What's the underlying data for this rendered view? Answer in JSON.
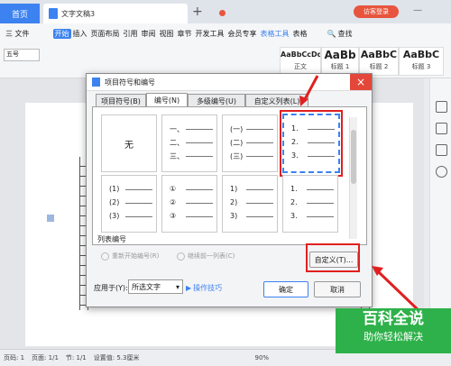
{
  "titlebar": {
    "home_tab": "首页",
    "doc_tab": "文字文稿3",
    "login": "访客登录"
  },
  "menubar": {
    "file": "三 文件",
    "items": [
      "开始",
      "插入",
      "页面布局",
      "引用",
      "审阅",
      "视图",
      "章节",
      "开发工具",
      "会员专享",
      "表格工具",
      "表格"
    ],
    "search": "查找"
  },
  "ribbon": {
    "font_size": "五号",
    "styles": [
      {
        "sample": "AaBbCcDd",
        "name": "正文"
      },
      {
        "sample": "AaBb",
        "name": "标题 1"
      },
      {
        "sample": "AaBbC",
        "name": "标题 2"
      },
      {
        "sample": "AaBbC",
        "name": "标题 3"
      }
    ]
  },
  "dialog": {
    "title": "项目符号和编号",
    "tabs": [
      "项目符号(B)",
      "编号(N)",
      "多级编号(U)",
      "自定义列表(L)"
    ],
    "active_tab": "编号(N)",
    "none_label": "无",
    "cells_row1": [
      [
        "一、",
        "二、",
        "三、"
      ],
      [
        "(一)",
        "(二)",
        "(三)"
      ],
      [
        "1.",
        "2.",
        "3."
      ]
    ],
    "cells_row2": [
      [
        "(1)",
        "(2)",
        "(3)"
      ],
      [
        "①",
        "②",
        "③"
      ],
      [
        "1)",
        "2)",
        "3)"
      ],
      [
        "1.",
        "2.",
        "3."
      ]
    ],
    "list_numbering_label": "列表编号",
    "restart_label": "重新开始编号(R)",
    "continue_label": "继续前一列表(C)",
    "custom_button": "自定义(T)...",
    "apply_label": "应用于(Y):",
    "apply_value": "所选文字",
    "tips_label": "操作技巧",
    "ok": "确定",
    "cancel": "取消"
  },
  "statusbar": {
    "page": "页码: 1",
    "pages": "页面: 1/1",
    "section": "节: 1/1",
    "settings": "设置值: 5.3厘米",
    "zoom": "90%"
  },
  "watermark": {
    "line1": "百科全说",
    "line2": "助你轻松解决"
  }
}
